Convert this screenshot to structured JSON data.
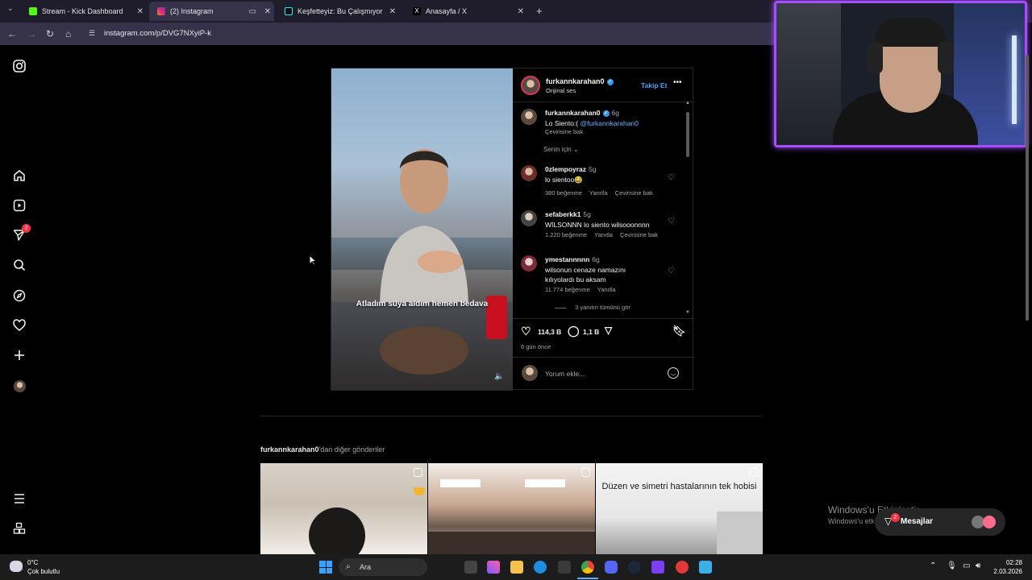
{
  "browser": {
    "tabs": [
      {
        "title": "Stream - Kick Dashboard",
        "favicon_color": "#53fc18",
        "active": false
      },
      {
        "title": "(2) Instagram",
        "favicon_color": "#e1306c",
        "active": true
      },
      {
        "title": "Keşfetteyiz: Bu Çalışmıyor | TikT",
        "favicon_color": "#000000",
        "active": false
      },
      {
        "title": "Anasayfa / X",
        "favicon_color": "#000000",
        "active": false
      }
    ],
    "new_tab_icon": "plus-icon",
    "url": "instagram.com/p/DVG7NXyiP-k"
  },
  "instagram": {
    "sidebar": {
      "notification_badge": "2",
      "icons": [
        "instagram-logo-icon",
        "home-icon",
        "reels-icon",
        "direct-icon",
        "search-icon",
        "explore-icon",
        "heart-icon",
        "create-icon",
        "avatar",
        "menu-icon",
        "apps-icon"
      ]
    },
    "post": {
      "username": "furkannkarahan0",
      "audio": "Orijinal ses",
      "follow_label": "Takip Et",
      "video_caption": "Atladım suya aldım hemen bedava",
      "caption": {
        "username": "furkannkarahan0",
        "time": "6g",
        "text": "Lo Siento:(",
        "mention": "@furkannkarahan0",
        "translate": "Çevirisine bak"
      },
      "sort_label": "Senin için",
      "comments": [
        {
          "username": "0zlempoyraz",
          "time": "5g",
          "text": "lo sientoo😂",
          "likes": "380 beğenme",
          "reply": "Yanıtla",
          "translate": "Çevirisine bak"
        },
        {
          "username": "sefaberkk1",
          "time": "5g",
          "text": "WİLSONNN lo siento wilsooonnnn",
          "likes": "1.220 beğenme",
          "reply": "Yanıtla",
          "translate": "Çevirisine bak"
        },
        {
          "username": "ymestannnnn",
          "time": "6g",
          "text": "wilsonun cenaze namazını kılıyolardı bu aksam",
          "likes": "11.774 beğenme",
          "reply": "Yanıtla",
          "translate": ""
        }
      ],
      "view_replies": "3 yanıtın tümünü gör",
      "like_count": "114,3 B",
      "comment_count": "1,1 B",
      "time_ago": "6 gün önce",
      "comment_placeholder": "Yorum ekle..."
    },
    "more_posts": {
      "username": "furkannkarahan0",
      "suffix": "'dan diğer gönderiler",
      "third_caption": "Düzen ve simetri hastalarının tek hobisi"
    }
  },
  "overlay": {
    "windows_activation_title": "Windows'u Etkinleştir",
    "windows_activation_sub": "Windows'u etkinleştirmek için Ayarlar'a gidin.",
    "messages_label": "Mesajlar",
    "messages_badge": "2"
  },
  "taskbar": {
    "weather_temp": "0°C",
    "weather_desc": "Çok bulutlu",
    "search_label": "Ara",
    "time": "02:28",
    "date": "2.03.2026"
  },
  "colors": {
    "accent_blue": "#4aa3ff",
    "webcam_border": "#a64dff",
    "badge_red": "#ff3040"
  }
}
